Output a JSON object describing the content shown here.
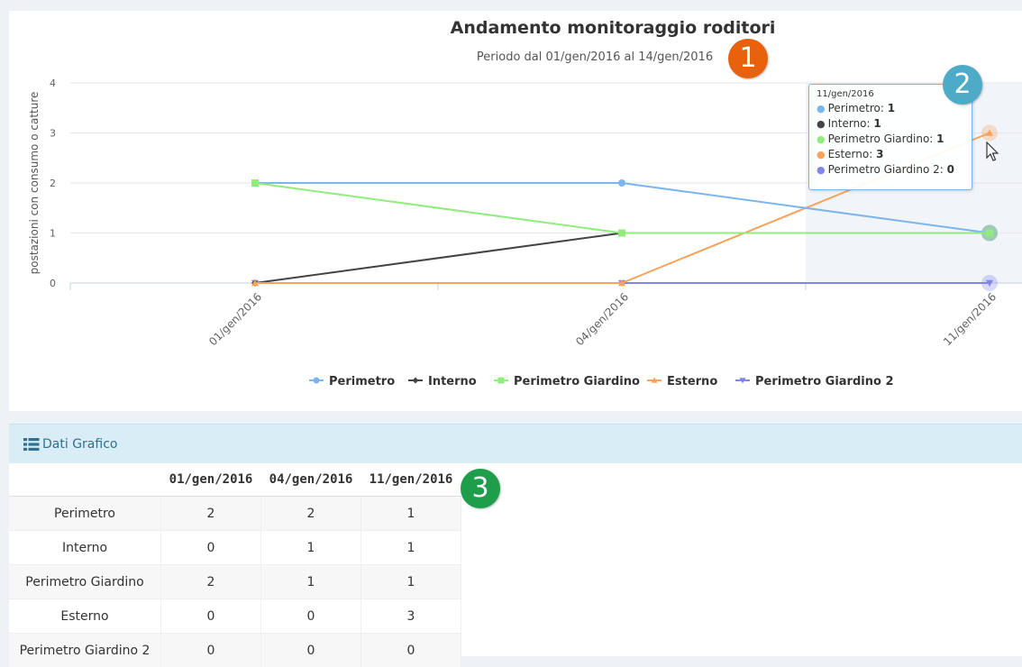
{
  "chart_data": {
    "type": "line",
    "title": "Andamento monitoraggio roditori",
    "subtitle": "Periodo dal 01/gen/2016 al 14/gen/2016",
    "ylabel": "postazioni con consumo o catture",
    "categories": [
      "01/gen/2016",
      "04/gen/2016",
      "11/gen/2016"
    ],
    "yticks": [
      0,
      1,
      2,
      3,
      4
    ],
    "ylim": [
      0,
      4
    ],
    "grid": true,
    "legend_position": "bottom",
    "highlighted_category": "11/gen/2016",
    "series": [
      {
        "name": "Perimetro",
        "values": [
          2,
          2,
          1
        ],
        "color": "#7cb5ec",
        "marker": "circle"
      },
      {
        "name": "Interno",
        "values": [
          0,
          1,
          1
        ],
        "color": "#434348",
        "marker": "diamond"
      },
      {
        "name": "Perimetro Giardino",
        "values": [
          2,
          1,
          1
        ],
        "color": "#90ed7d",
        "marker": "square"
      },
      {
        "name": "Esterno",
        "values": [
          0,
          0,
          3
        ],
        "color": "#f7a35c",
        "marker": "triangle"
      },
      {
        "name": "Perimetro Giardino 2",
        "values": [
          0,
          0,
          0
        ],
        "color": "#8085e9",
        "marker": "triangle-down"
      }
    ]
  },
  "tooltip": {
    "header": "11/gen/2016",
    "rows": [
      {
        "name": "Perimetro",
        "value": "1",
        "color": "#7cb5ec"
      },
      {
        "name": "Interno",
        "value": "1",
        "color": "#434348"
      },
      {
        "name": "Perimetro Giardino",
        "value": "1",
        "color": "#90ed7d"
      },
      {
        "name": "Esterno",
        "value": "3",
        "color": "#f7a35c"
      },
      {
        "name": "Perimetro Giardino 2",
        "value": "0",
        "color": "#8085e9"
      }
    ]
  },
  "callouts": [
    {
      "label": "1",
      "color": "#e8620e"
    },
    {
      "label": "2",
      "color": "#4eabc8"
    },
    {
      "label": "3",
      "color": "#1e9e4a"
    }
  ],
  "panel": {
    "title": "Dati Grafico",
    "icon": "list-icon"
  },
  "table": {
    "headers": [
      "",
      "01/gen/2016",
      "04/gen/2016",
      "11/gen/2016"
    ],
    "rows": [
      {
        "name": "Perimetro",
        "values": [
          "2",
          "2",
          "1"
        ]
      },
      {
        "name": "Interno",
        "values": [
          "0",
          "1",
          "1"
        ]
      },
      {
        "name": "Perimetro Giardino",
        "values": [
          "2",
          "1",
          "1"
        ]
      },
      {
        "name": "Esterno",
        "values": [
          "0",
          "0",
          "3"
        ]
      },
      {
        "name": "Perimetro Giardino 2",
        "values": [
          "0",
          "0",
          "0"
        ]
      }
    ]
  }
}
